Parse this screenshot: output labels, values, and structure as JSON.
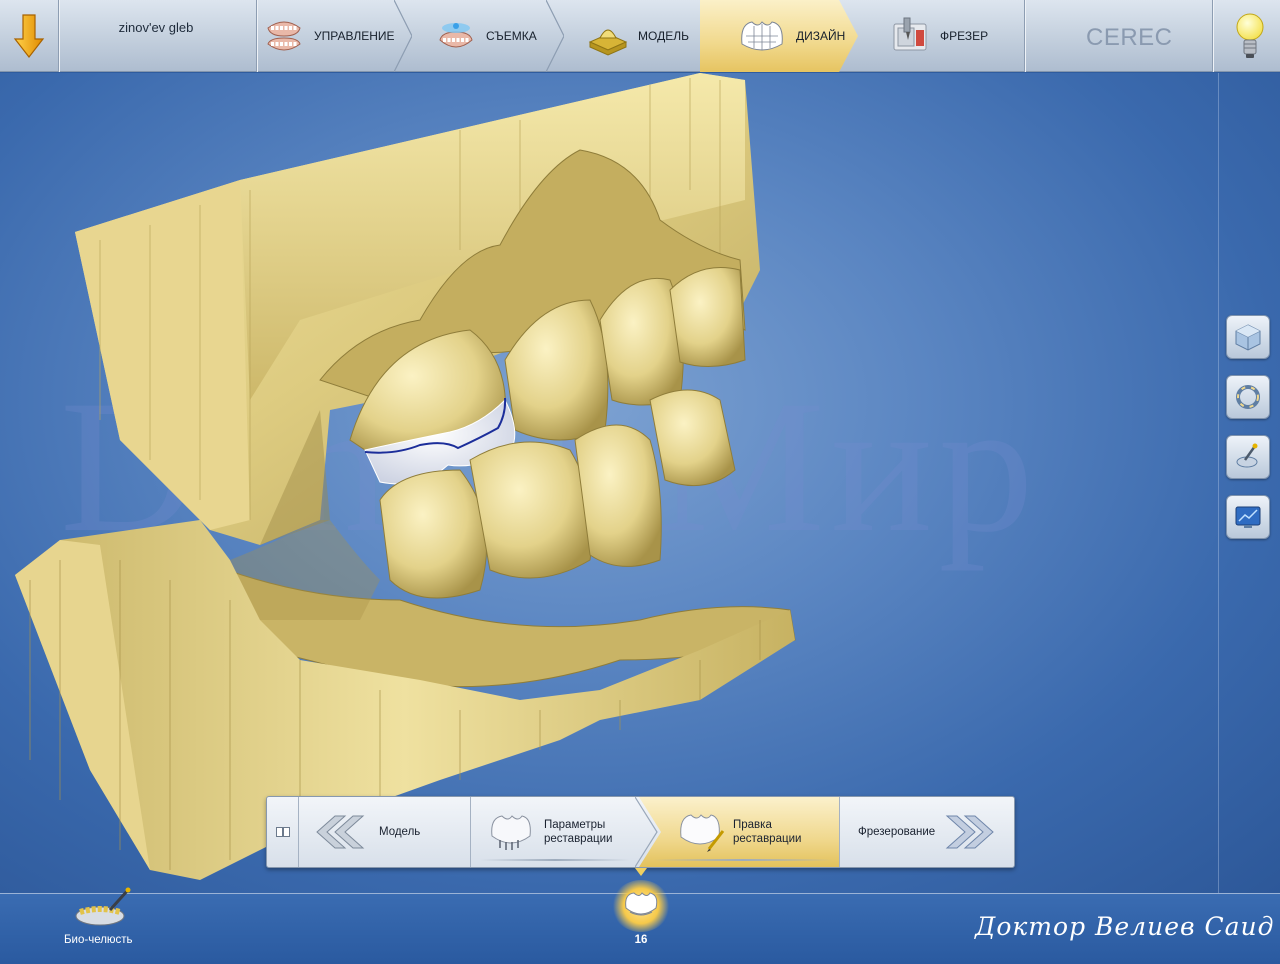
{
  "app": {
    "brand": "CEREC"
  },
  "patient": {
    "name": "zinov'ev gleb"
  },
  "steps": [
    {
      "label": "УПРАВЛЕНИЕ",
      "icon": "jaw-icon",
      "active": false
    },
    {
      "label": "СЪЕМКА",
      "icon": "scan-jaw-icon",
      "active": false
    },
    {
      "label": "МОДЕЛЬ",
      "icon": "model-icon",
      "active": false
    },
    {
      "label": "ДИЗАЙН",
      "icon": "crown-design-icon",
      "active": true
    },
    {
      "label": "ФРЕЗЕР",
      "icon": "milling-icon",
      "active": false
    }
  ],
  "watermark": "Dental Мир",
  "side_tools": [
    {
      "icon": "cube-view-icon"
    },
    {
      "icon": "rotate-ring-icon"
    },
    {
      "icon": "tool-wand-icon"
    },
    {
      "icon": "screenshot-icon"
    }
  ],
  "workflow": {
    "prev": "Модель",
    "items": [
      {
        "line1": "Параметры",
        "line2": "реставрации",
        "active": false
      },
      {
        "line1": "Правка",
        "line2": "реставрации",
        "active": true
      }
    ],
    "next": "Фрезерование"
  },
  "bottom": {
    "bio_label": "Био-челюсть",
    "tooth_number": "16",
    "signature": "Доктор Велиев Саид"
  },
  "colors": {
    "accent_gold": "#f0d88e",
    "background_blue": "#4b78b8",
    "model_yellow": "#e3d48f",
    "restoration_outline": "#1c2e9a"
  }
}
